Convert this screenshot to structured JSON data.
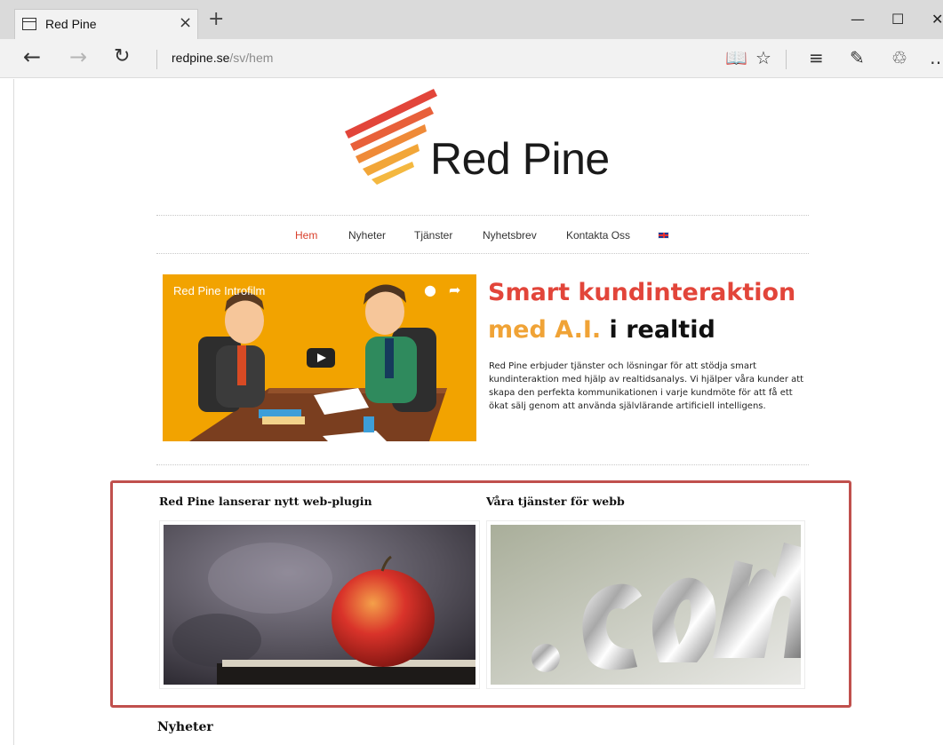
{
  "browser": {
    "tab_title": "Red Pine",
    "tab_close": "×",
    "new_tab": "+",
    "url_host": "redpine.se",
    "url_path": "/sv/hem",
    "icons": [
      "tab-page-icon",
      "back-arrow-icon",
      "forward-arrow-icon",
      "refresh-icon",
      "reading-view-icon",
      "favorite-star-icon",
      "hub-icon",
      "web-note-icon",
      "share-icon",
      "more-icon",
      "minimize-icon",
      "maximize-icon",
      "close-window-icon"
    ]
  },
  "site": {
    "brand": "Red Pine",
    "colors": {
      "accent_red": "#e2453a",
      "accent_orange": "#f0a336",
      "highlight": "#c0504d"
    },
    "nav": [
      {
        "label": "Hem",
        "active": true
      },
      {
        "label": "Nyheter",
        "active": false
      },
      {
        "label": "Tjänster",
        "active": false
      },
      {
        "label": "Nyhetsbrev",
        "active": false
      },
      {
        "label": "Kontakta Oss",
        "active": false
      }
    ],
    "language_flag": "uk-flag-icon"
  },
  "video": {
    "title": "Red Pine Introfilm"
  },
  "hero": {
    "line1": "Smart kundinteraktion",
    "line2_orange": "med A.I.",
    "line2_dark": "i realtid",
    "intro": "Red Pine erbjuder tjänster och lösningar för att stödja smart kundinteraktion med hjälp av realtidsanalys. Vi hjälper våra kunder att skapa den perfekta kommunikationen i varje kundmöte för att få ett ökat sälj genom att använda självlärande artificiell intelligens."
  },
  "cards": [
    {
      "title": "Red Pine lanserar nytt web-plugin"
    },
    {
      "title": "Våra tjänster för webb"
    }
  ],
  "news": {
    "title": "Nyheter"
  }
}
